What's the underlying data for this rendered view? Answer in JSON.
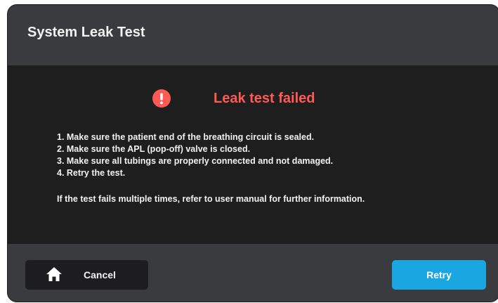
{
  "dialog": {
    "title": "System Leak Test",
    "status": {
      "icon": "alert-circle-icon",
      "text": "Leak test failed",
      "color": "#ff5a54"
    },
    "steps": [
      "1. Make sure the patient end of the breathing circuit is sealed.",
      "2. Make sure the APL (pop-off) valve is closed.",
      "3. Make sure all tubings are properly connected and not damaged.",
      "4. Retry the test."
    ],
    "note": "If the test fails multiple times, refer to user manual for further information."
  },
  "footer": {
    "cancel": {
      "label": "Cancel",
      "icon": "home-icon"
    },
    "retry": {
      "label": "Retry",
      "color": "#1aa6e0"
    }
  }
}
